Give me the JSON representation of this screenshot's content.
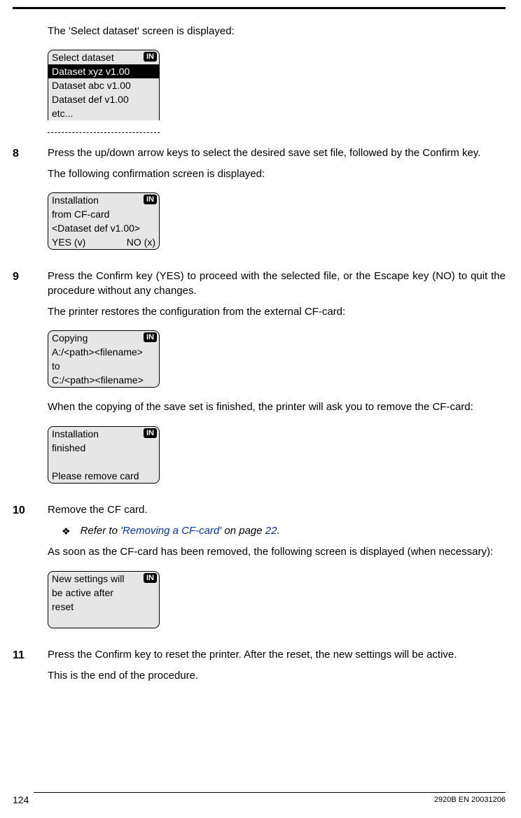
{
  "intro": "The 'Select dataset' screen is displayed:",
  "lcd1": {
    "badge": "IN",
    "line1": "Select dataset",
    "line2": "Dataset xyz v1.00",
    "line3": "Dataset abc v1.00",
    "line4": "Dataset def v1.00",
    "line5": "etc..."
  },
  "step8": {
    "num": "8",
    "p1": "Press the up/down arrow keys to select the desired save set file, followed by the Confirm key.",
    "p2": "The following confirmation screen is displayed:"
  },
  "lcd2": {
    "badge": "IN",
    "line1": "Installation",
    "line2": "from CF-card",
    "line3": "<Dataset def v1.00>",
    "line4a": "YES (v)",
    "line4b": "NO (x)"
  },
  "step9": {
    "num": "9",
    "p1": "Press the Confirm key (YES) to proceed with the selected file, or the Escape key (NO) to quit the procedure without any changes.",
    "p2": "The printer restores the configuration from the external CF-card:"
  },
  "lcd3": {
    "badge": "IN",
    "line1": "Copying",
    "line2": "A:/<path><filename>",
    "line3": "to",
    "line4": "C:/<path><filename>"
  },
  "after9": "When the copying of the save set is finished, the printer will ask you to remove the CF-card:",
  "lcd4": {
    "badge": "IN",
    "line1": "Installation",
    "line2": "finished",
    "line3": "",
    "line4": "Please remove card"
  },
  "step10": {
    "num": "10",
    "p1": "Remove the CF card.",
    "bullet_prefix": "Refer to ",
    "bullet_link": "'Removing a CF-card'",
    "bullet_mid": " on page ",
    "bullet_page": "22",
    "bullet_suffix": ".",
    "p2": "As soon as the CF-card has been removed, the following screen is displayed (when necessary):"
  },
  "lcd5": {
    "badge": "IN",
    "line1": "New settings will",
    "line2": "be active after",
    "line3": "reset",
    "line4": ""
  },
  "step11": {
    "num": "11",
    "p1": "Press the Confirm key to reset the printer. After the reset, the new settings will be active.",
    "p2": "This is the end of the procedure."
  },
  "footer": {
    "page": "124",
    "doc": "2920B EN 20031206"
  },
  "diamond": "❖"
}
